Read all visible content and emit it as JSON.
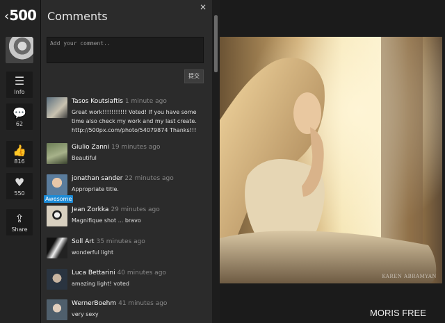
{
  "app": {
    "logo": "500",
    "back_glyph": "‹"
  },
  "rail": {
    "info_label": "Info",
    "comments_count": "62",
    "likes_count": "816",
    "favorites_count": "550",
    "share_label": "Share"
  },
  "panel": {
    "title": "Comments",
    "close_glyph": "×",
    "comment_placeholder": "Add your comment..",
    "submit_label": "提交"
  },
  "comments": [
    {
      "name": "Tasos Koutsiaftis",
      "time": "1 minute ago",
      "text": "Great work!!!!!!!!!!! Voted! If you have some time also check my work and my last create. http://500px.com/photo/54079874 Thanks!!!"
    },
    {
      "name": "Giulio Zanni",
      "time": "19 minutes ago",
      "text": "Beautiful"
    },
    {
      "name": "jonathan sander",
      "time": "22 minutes ago",
      "text": "Appropriate title.",
      "badge": "Awesome"
    },
    {
      "name": "Jean Zorkka",
      "time": "29 minutes ago",
      "text": "Magnifique shot ... bravo"
    },
    {
      "name": "Soll Art",
      "time": "35 minutes ago",
      "text": "wonderful light"
    },
    {
      "name": "Luca Bettarini",
      "time": "40 minutes ago",
      "text": "amazing light! voted"
    },
    {
      "name": "WernerBoehm",
      "time": "41 minutes ago",
      "text": "very sexy"
    }
  ],
  "photo": {
    "watermark": "KAREN ABRAMYAN",
    "photographer": "MORIS FREE"
  },
  "colors": {
    "panel_bg": "#2b2b2b",
    "rail_bg": "#232323",
    "badge": "#1d8bd6",
    "photo_light": "#f4dca0"
  }
}
